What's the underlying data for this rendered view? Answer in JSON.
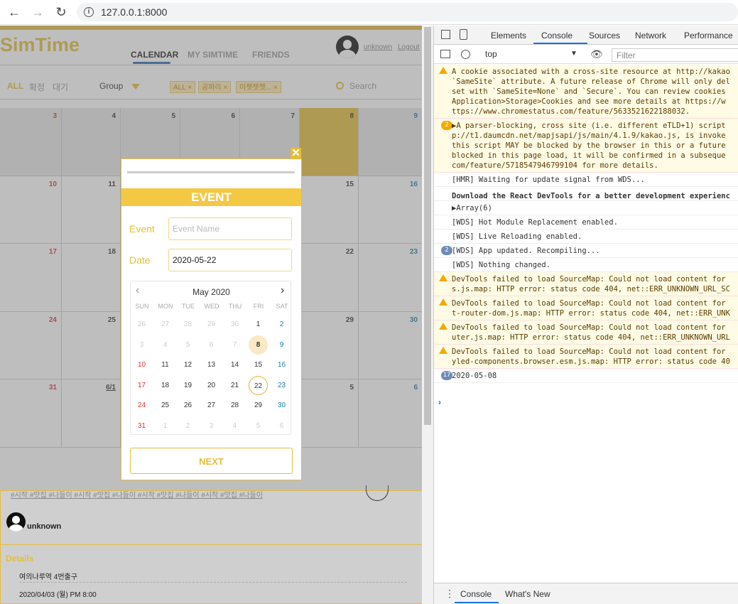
{
  "browser": {
    "url": "127.0.0.1:8000"
  },
  "app": {
    "logo": "SimTime",
    "tabs": [
      "CALENDAR",
      "MY SIMTIME",
      "FRIENDS"
    ],
    "user": "unknown",
    "logout": "Logout",
    "filters": {
      "all": "ALL",
      "confirmed": "확정",
      "waiting": "대기",
      "group": "Group",
      "search": "Search"
    },
    "chips": [
      "ALL",
      "공파리",
      "이젯젯젯..."
    ],
    "calendar_rows": [
      [
        "3",
        "4",
        "5",
        "6",
        "7",
        "8",
        "9"
      ],
      [
        "10",
        "11",
        "",
        "",
        "",
        "15",
        "16"
      ],
      [
        "17",
        "18",
        "",
        "",
        "",
        "22",
        "23"
      ],
      [
        "24",
        "25",
        "",
        "",
        "",
        "29",
        "30"
      ],
      [
        "31",
        "6/1",
        "",
        "",
        "",
        "5",
        "6"
      ]
    ],
    "post_tags": "#시작 #맛집 #나들이 #시작 #맛집 #나들이 #시작 #맛집 #나들이 #시작 #맛집 #나들이",
    "post_user": "unknown",
    "details_label": "Details",
    "detail_place": "여의나루역 4번출구",
    "detail_time": "2020/04/03 (월) PM 8:00"
  },
  "modal": {
    "title": "EVENT",
    "event_label": "Event",
    "event_placeholder": "Event Name",
    "date_label": "Date",
    "date_value": "2020-05-22",
    "month": "May 2020",
    "dow": [
      "SUN",
      "MON",
      "TUE",
      "WED",
      "THU",
      "FRI",
      "SAT"
    ],
    "weeks": [
      [
        "26",
        "27",
        "28",
        "29",
        "30",
        "1",
        "2"
      ],
      [
        "3",
        "4",
        "5",
        "6",
        "7",
        "8",
        "9"
      ],
      [
        "10",
        "11",
        "12",
        "13",
        "14",
        "15",
        "16"
      ],
      [
        "17",
        "18",
        "19",
        "20",
        "21",
        "22",
        "23"
      ],
      [
        "24",
        "25",
        "26",
        "27",
        "28",
        "29",
        "30"
      ],
      [
        "31",
        "1",
        "2",
        "3",
        "4",
        "5",
        "6"
      ]
    ],
    "next": "NEXT"
  },
  "devtools": {
    "tabs": [
      "Elements",
      "Console",
      "Sources",
      "Network",
      "Performance"
    ],
    "context": "top",
    "filter": "Filter",
    "footer_tabs": [
      "Console",
      "What's New"
    ],
    "logs": [
      {
        "type": "warn",
        "lines": [
          "A cookie associated with a cross-site resource at http://kakao",
          "`SameSite` attribute. A future release of Chrome will only del",
          "set with `SameSite=None` and `Secure`. You can review cookies",
          "Application>Storage>Cookies and see more details at https://w",
          "ttps://www.chromestatus.com/feature/5633521622188032."
        ]
      },
      {
        "type": "warn2",
        "badge": "2",
        "lines": [
          "▶A parser-blocking, cross site (i.e. different eTLD+1) script",
          "p://t1.daumcdn.net/mapjsapi/js/main/4.1.9/kakao.js, is invoke",
          "this script MAY be blocked by the browser in this or a future",
          "blocked in this page load, it will be confirmed in a subseque",
          "com/feature/5718547946799104 for more details."
        ]
      },
      {
        "type": "info",
        "lines": [
          "[HMR] Waiting for update signal from WDS..."
        ]
      },
      {
        "type": "bold",
        "lines": [
          "Download the React DevTools for a better development experienc"
        ]
      },
      {
        "type": "info",
        "lines": [
          "▶Array(6)"
        ]
      },
      {
        "type": "info",
        "lines": [
          "[WDS] Hot Module Replacement enabled."
        ]
      },
      {
        "type": "info",
        "lines": [
          "[WDS] Live Reloading enabled."
        ]
      },
      {
        "type": "info",
        "badge": "2",
        "lines": [
          "[WDS] App updated. Recompiling..."
        ]
      },
      {
        "type": "info",
        "lines": [
          "[WDS] Nothing changed."
        ]
      },
      {
        "type": "warn",
        "lines": [
          "DevTools failed to load SourceMap: Could not load content for",
          "s.js.map: HTTP error: status code 404, net::ERR_UNKNOWN_URL_SC"
        ]
      },
      {
        "type": "warn",
        "lines": [
          "DevTools failed to load SourceMap: Could not load content for",
          "t-router-dom.js.map: HTTP error: status code 404, net::ERR_UNK"
        ]
      },
      {
        "type": "warn",
        "lines": [
          "DevTools failed to load SourceMap: Could not load content for",
          "uter.js.map: HTTP error: status code 404, net::ERR_UNKNOWN_URL"
        ]
      },
      {
        "type": "warn",
        "lines": [
          "DevTools failed to load SourceMap: Could not load content for",
          "yled-components.browser.esm.js.map: HTTP error: status code 40"
        ]
      },
      {
        "type": "info",
        "badge": "17",
        "lines": [
          "2020-05-08"
        ]
      }
    ]
  }
}
